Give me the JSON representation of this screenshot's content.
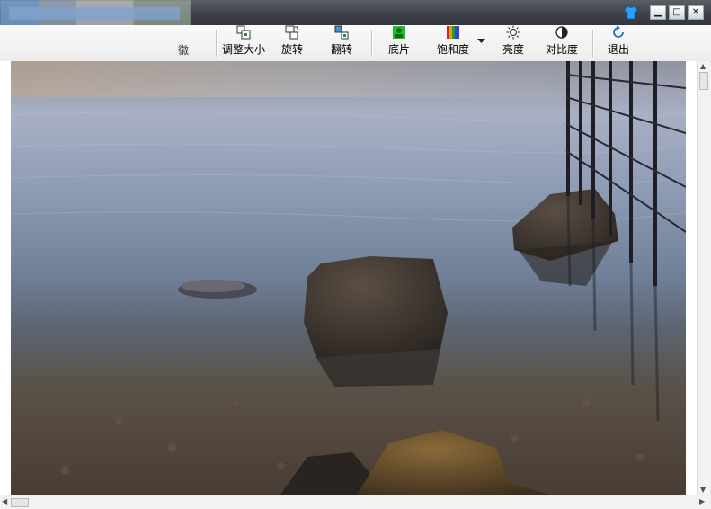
{
  "window": {
    "minimize": "▁",
    "maximize": "□",
    "close": "✕"
  },
  "toolbar": {
    "clipped_label": "徽",
    "items": [
      {
        "label": "调整大小",
        "icon": "resize-icon"
      },
      {
        "label": "旋转",
        "icon": "rotate-icon"
      },
      {
        "label": "翻转",
        "icon": "flip-icon"
      },
      {
        "label": "底片",
        "icon": "negative-icon"
      },
      {
        "label": "饱和度",
        "icon": "saturation-icon"
      },
      {
        "label": "亮度",
        "icon": "brightness-icon"
      },
      {
        "label": "对比度",
        "icon": "contrast-icon"
      },
      {
        "label": "退出",
        "icon": "exit-icon"
      }
    ]
  },
  "colors": {
    "titlebar": "#3d4048",
    "toolbar": "#f0f0f0",
    "accent_blue": "#1e6fd0"
  }
}
